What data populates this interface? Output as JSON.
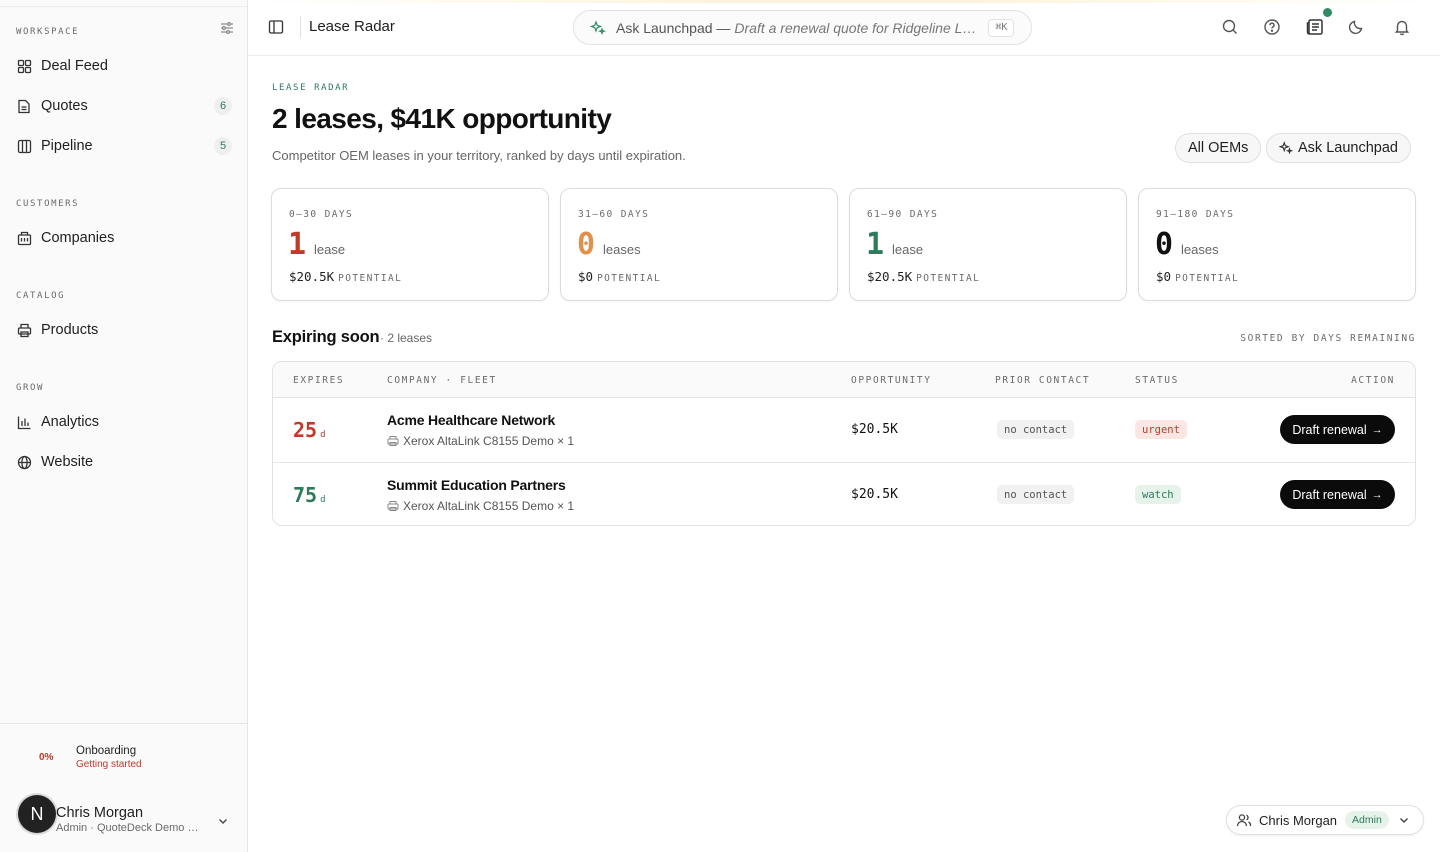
{
  "sidebar": {
    "sections": [
      {
        "label": "WORKSPACE"
      },
      {
        "label": "CUSTOMERS"
      },
      {
        "label": "CATALOG"
      },
      {
        "label": "GROW"
      }
    ],
    "items": [
      {
        "label": "Deal Feed",
        "icon": "grid-icon"
      },
      {
        "label": "Quotes",
        "icon": "document-icon",
        "count": "6"
      },
      {
        "label": "Pipeline",
        "icon": "columns-icon",
        "count": "5"
      },
      {
        "label": "Companies",
        "icon": "building-icon"
      },
      {
        "label": "Products",
        "icon": "printer-icon"
      },
      {
        "label": "Analytics",
        "icon": "bar-chart-icon"
      },
      {
        "label": "Website",
        "icon": "globe-icon"
      }
    ],
    "onboarding": {
      "percent": "0%",
      "title": "Onboarding",
      "subtitle": "Getting started"
    },
    "user": {
      "initial": "N",
      "name": "Chris Morgan",
      "subtitle": "Admin · QuoteDeck Demo Company"
    }
  },
  "topbar": {
    "title": "Lease Radar",
    "ask_label": "Ask Launchpad —",
    "ask_hint": "Draft a renewal quote for Ridgeline Legal Services",
    "shortcut": "⌘K"
  },
  "header": {
    "eyebrow": "LEASE RADAR",
    "title": "2 leases, $41K opportunity",
    "subtitle": "Competitor OEM leases in your territory, ranked by days until expiration.",
    "filter_button": "All OEMs",
    "ask_button": "Ask Launchpad"
  },
  "cards": [
    {
      "range": "0–30 DAYS",
      "count": "1",
      "unit": "lease",
      "amount": "$20.5K",
      "potential": "POTENTIAL",
      "color": "#c0392b"
    },
    {
      "range": "31–60 DAYS",
      "count": "0",
      "unit": "leases",
      "amount": "$0",
      "potential": "POTENTIAL",
      "color": "#e3914a"
    },
    {
      "range": "61–90 DAYS",
      "count": "1",
      "unit": "lease",
      "amount": "$20.5K",
      "potential": "POTENTIAL",
      "color": "#2e7a5a"
    },
    {
      "range": "91–180 DAYS",
      "count": "0",
      "unit": "leases",
      "amount": "$0",
      "potential": "POTENTIAL",
      "color": "#111111"
    }
  ],
  "expiring": {
    "title": "Expiring soon",
    "count": "· 2 leases",
    "sorted": "SORTED BY DAYS REMAINING",
    "columns": {
      "expires": "EXPIRES",
      "company": "COMPANY · FLEET",
      "opportunity": "OPPORTUNITY",
      "contact": "PRIOR CONTACT",
      "status": "STATUS",
      "action": "ACTION"
    },
    "rows": [
      {
        "days": "25",
        "unit": "d",
        "company": "Acme Healthcare Network",
        "fleet": "Xerox AltaLink C8155 Demo × 1",
        "opportunity": "$20.5K",
        "contact": "no contact",
        "status": "urgent",
        "action": "Draft renewal",
        "color": "#c0392b"
      },
      {
        "days": "75",
        "unit": "d",
        "company": "Summit Education Partners",
        "fleet": "Xerox AltaLink C8155 Demo × 1",
        "opportunity": "$20.5K",
        "contact": "no contact",
        "status": "watch",
        "action": "Draft renewal",
        "color": "#2e7a5a"
      }
    ]
  },
  "user_pill": {
    "name": "Chris Morgan",
    "role": "Admin"
  }
}
